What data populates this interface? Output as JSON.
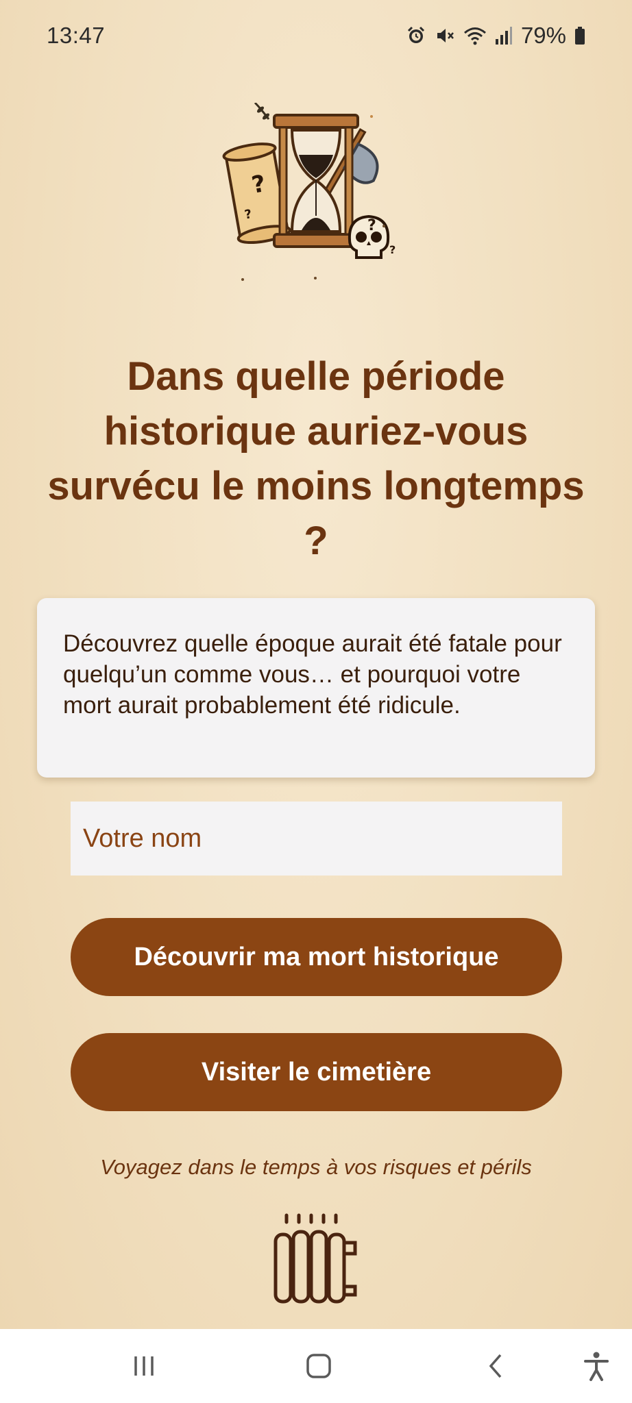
{
  "status_bar": {
    "time": "13:47",
    "battery": "79%",
    "icons": [
      "alarm-icon",
      "mute-icon",
      "wifi-icon",
      "signal-icon",
      "battery-icon"
    ]
  },
  "hero": {
    "icon": "hourglass-scroll-skull-axe-illustration"
  },
  "title": "Dans quelle période historique auriez-vous survécu le moins longtemps ?",
  "description": "Découvrez quelle époque aurait été fatale pour quelqu’un comme vous… et pourquoi votre mort aurait probablement été ridicule.",
  "name_input": {
    "placeholder": "Votre nom",
    "value": ""
  },
  "buttons": {
    "discover": "Découvrir ma mort historique",
    "cemetery": "Visiter le cimetière"
  },
  "tagline": "Voyagez dans le temps à vos risques et périls",
  "footer_icon": "radiator-icon",
  "nav": [
    "recent-apps-icon",
    "home-icon",
    "back-icon",
    "accessibility-icon"
  ],
  "colors": {
    "primary": "#8b4513",
    "title": "#6b3410",
    "background": "#f1dfbf",
    "card": "#f4f3f4"
  }
}
